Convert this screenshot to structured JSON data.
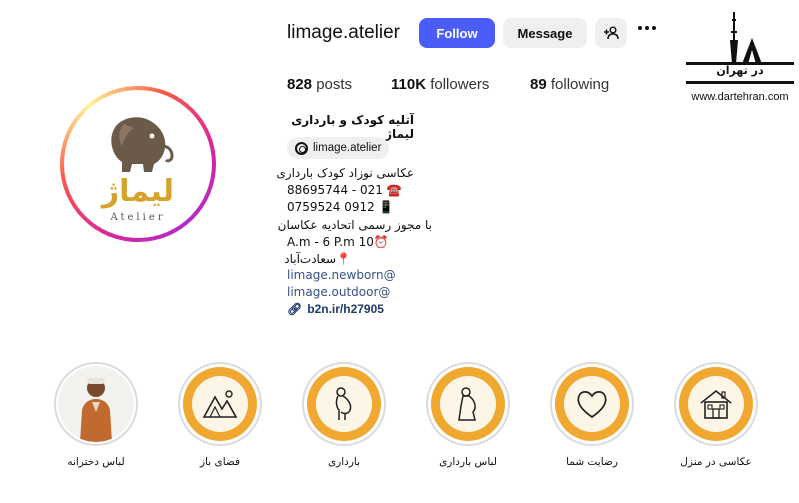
{
  "profile": {
    "username": "limage.atelier",
    "follow_label": "Follow",
    "message_label": "Message",
    "logo_text": "لیماژ",
    "logo_subtext": "Atelier"
  },
  "stats": {
    "posts_count": "828",
    "posts_label": "posts",
    "followers_count": "110K",
    "followers_label": "followers",
    "following_count": "89",
    "following_label": "following"
  },
  "bio": {
    "name": "آتلیه کودک و بارداری لیماژ",
    "threads_handle": "limage.atelier",
    "lines": [
      "عکاسی نوزاد کودک بارداری",
      "88695744 - 021 ☎️",
      "0759524 0912 📱",
      "با مجوز رسمی اتحادیه عکاسان",
      "A.m - 6 P.m 10⏰",
      "📍سعادت‌آباد"
    ],
    "mentions": [
      "limage.newborn@",
      "limage.outdoor@"
    ],
    "external_link": "b2n.ir/h27905"
  },
  "watermark": {
    "title": "در تهران",
    "url": "www.dartehran.com"
  },
  "highlights": [
    {
      "label": "لباس دخترانه",
      "icon": "girl-photo"
    },
    {
      "label": "فضای باز",
      "icon": "mountains-icon"
    },
    {
      "label": "بارداری",
      "icon": "pregnant-icon"
    },
    {
      "label": "لباس بارداری",
      "icon": "pregnant-dress-icon"
    },
    {
      "label": "رضایت شما",
      "icon": "heart-icon"
    },
    {
      "label": "عکاسی در منزل",
      "icon": "house-icon"
    }
  ],
  "colors": {
    "follow_button": "#4a5df9",
    "highlight_ring": "#f0a830",
    "link": "#385185"
  }
}
